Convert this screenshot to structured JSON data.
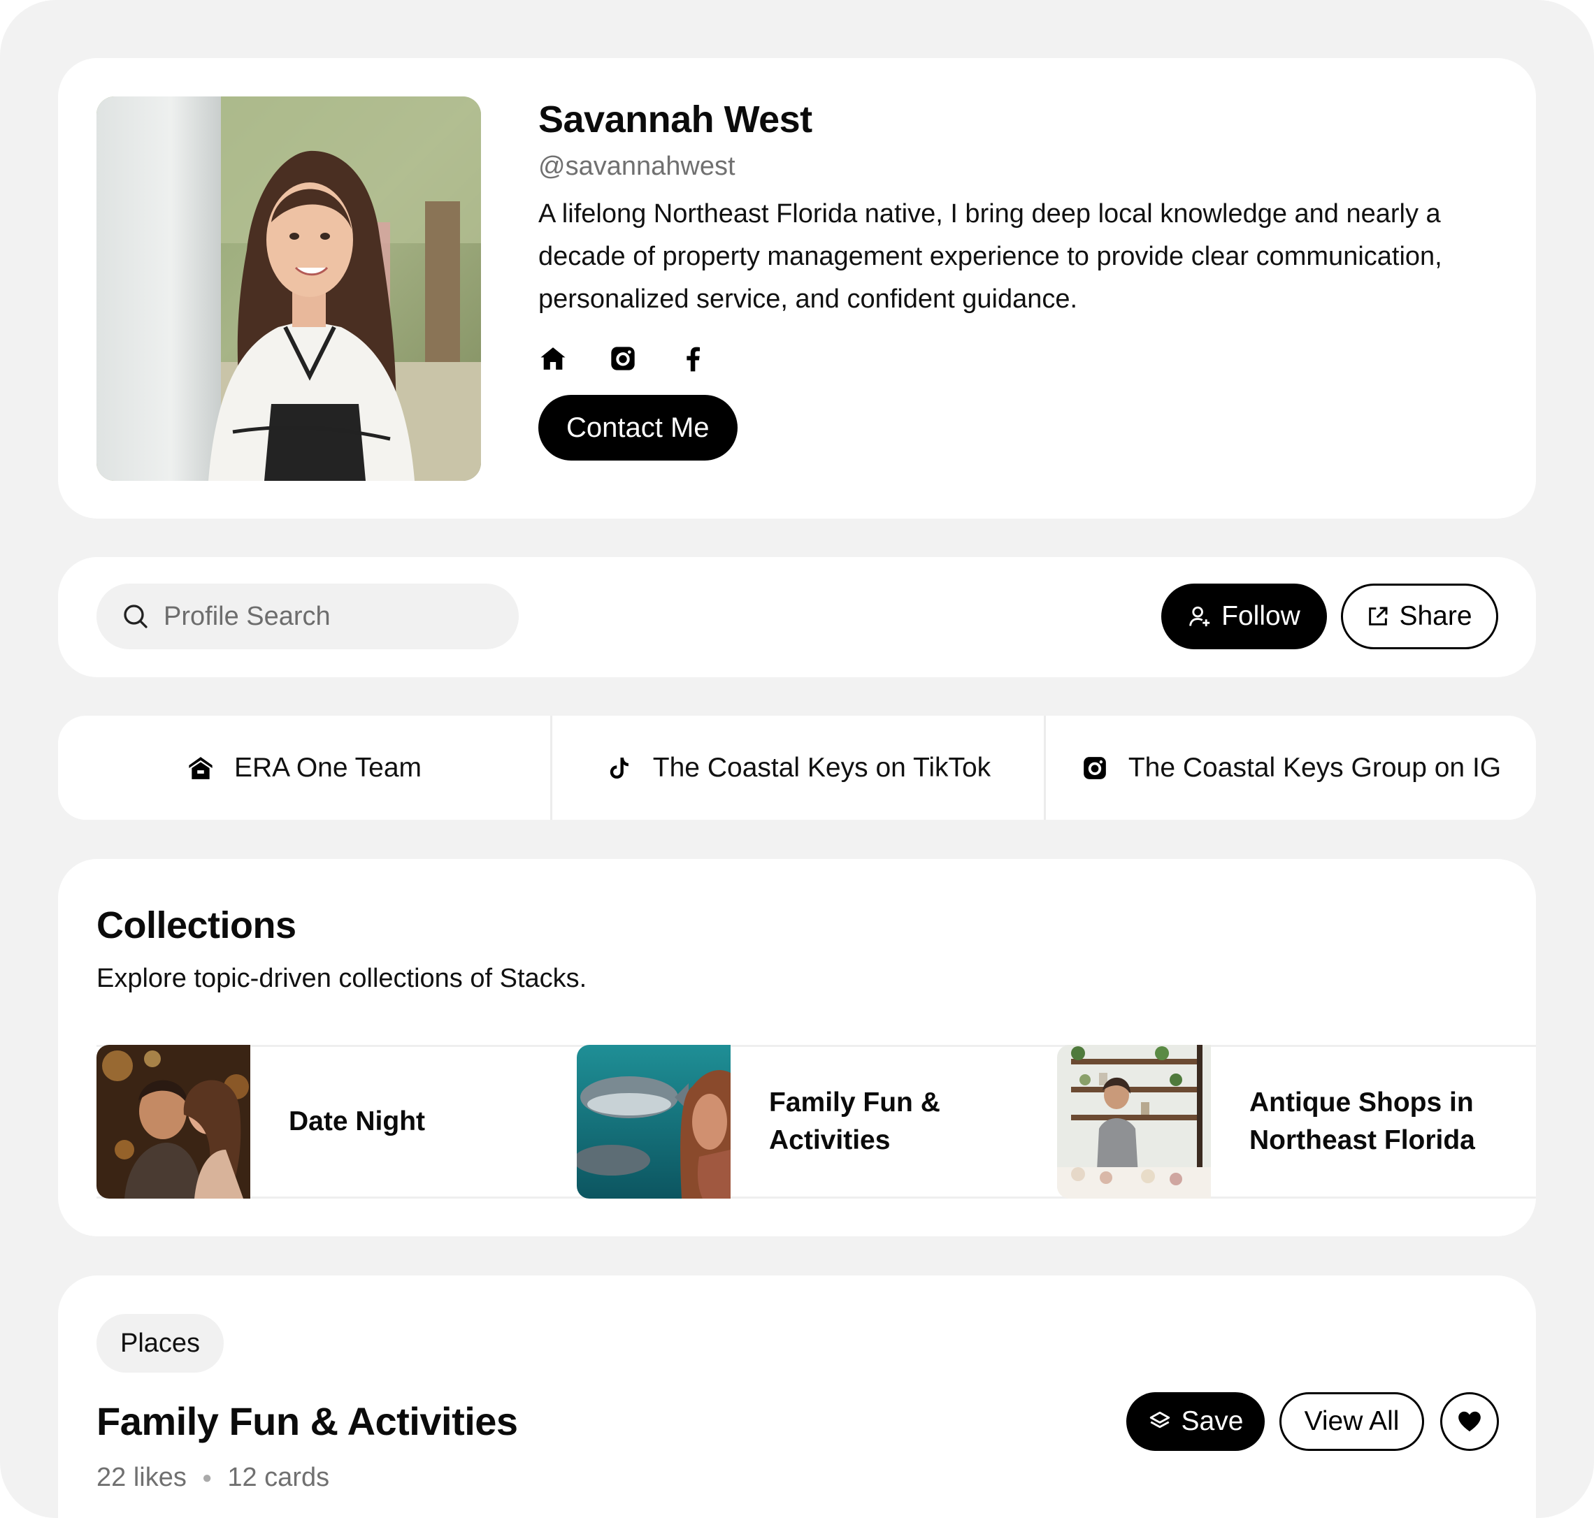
{
  "profile": {
    "name": "Savannah West",
    "handle": "@savannahwest",
    "bio": "A lifelong Northeast Florida native, I bring deep local knowledge and nearly a decade of property management experience to provide clear communication, personalized service, and confident guidance.",
    "social_icons": [
      "home-icon",
      "instagram-icon",
      "facebook-icon"
    ],
    "contact_label": "Contact Me"
  },
  "toolbar": {
    "search_placeholder": "Profile Search",
    "follow_label": "Follow",
    "share_label": "Share"
  },
  "links": [
    {
      "icon": "home-icon",
      "label": "ERA One Team"
    },
    {
      "icon": "tiktok-icon",
      "label": "The Coastal Keys on TikTok"
    },
    {
      "icon": "instagram-icon",
      "label": "The Coastal Keys Group on IG"
    }
  ],
  "collections": {
    "title": "Collections",
    "subtitle": "Explore topic-driven collections of Stacks.",
    "items": [
      {
        "label": "Date Night"
      },
      {
        "label": "Family Fun & Activities"
      },
      {
        "label": "Antique Shops in Northeast Florida"
      }
    ]
  },
  "stack": {
    "tag": "Places",
    "title": "Family Fun & Activities",
    "likes": "22 likes",
    "cards": "12 cards",
    "save_label": "Save",
    "view_all_label": "View All"
  },
  "colors": {
    "background": "#f2f2f2",
    "card": "#ffffff",
    "primary_button": "#000000",
    "muted_text": "#707070"
  }
}
